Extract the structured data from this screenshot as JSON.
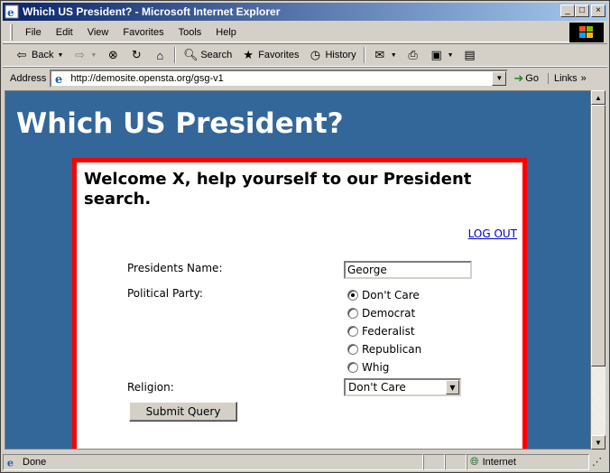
{
  "window": {
    "title": "Which US President? - Microsoft Internet Explorer",
    "minimize": "_",
    "maximize": "□",
    "close": "×"
  },
  "menu": {
    "items": [
      {
        "label": "File"
      },
      {
        "label": "Edit"
      },
      {
        "label": "View"
      },
      {
        "label": "Favorites"
      },
      {
        "label": "Tools"
      },
      {
        "label": "Help"
      }
    ]
  },
  "toolbar": {
    "back": "Back",
    "search": "Search",
    "favorites": "Favorites",
    "history": "History"
  },
  "address": {
    "label": "Address",
    "url": "http://demosite.opensta.org/gsg-v1",
    "go": "Go",
    "links": "Links"
  },
  "page": {
    "title": "Which US President?",
    "welcome": "Welcome X, help yourself to our President search.",
    "logout": "LOG OUT",
    "name_label": "Presidents Name:",
    "name_value": "George",
    "party_label": "Political Party:",
    "parties": [
      {
        "label": "Don't Care",
        "checked": true
      },
      {
        "label": "Democrat",
        "checked": false
      },
      {
        "label": "Federalist",
        "checked": false
      },
      {
        "label": "Republican",
        "checked": false
      },
      {
        "label": "Whig",
        "checked": false
      }
    ],
    "religion_label": "Religion:",
    "religion_value": "Don't Care",
    "submit": "Submit Query"
  },
  "status": {
    "text": "Done",
    "zone": "Internet"
  },
  "colors": {
    "page_bg": "#336699",
    "panel_border": "#ff0000",
    "title_bar": "#0a246a"
  }
}
